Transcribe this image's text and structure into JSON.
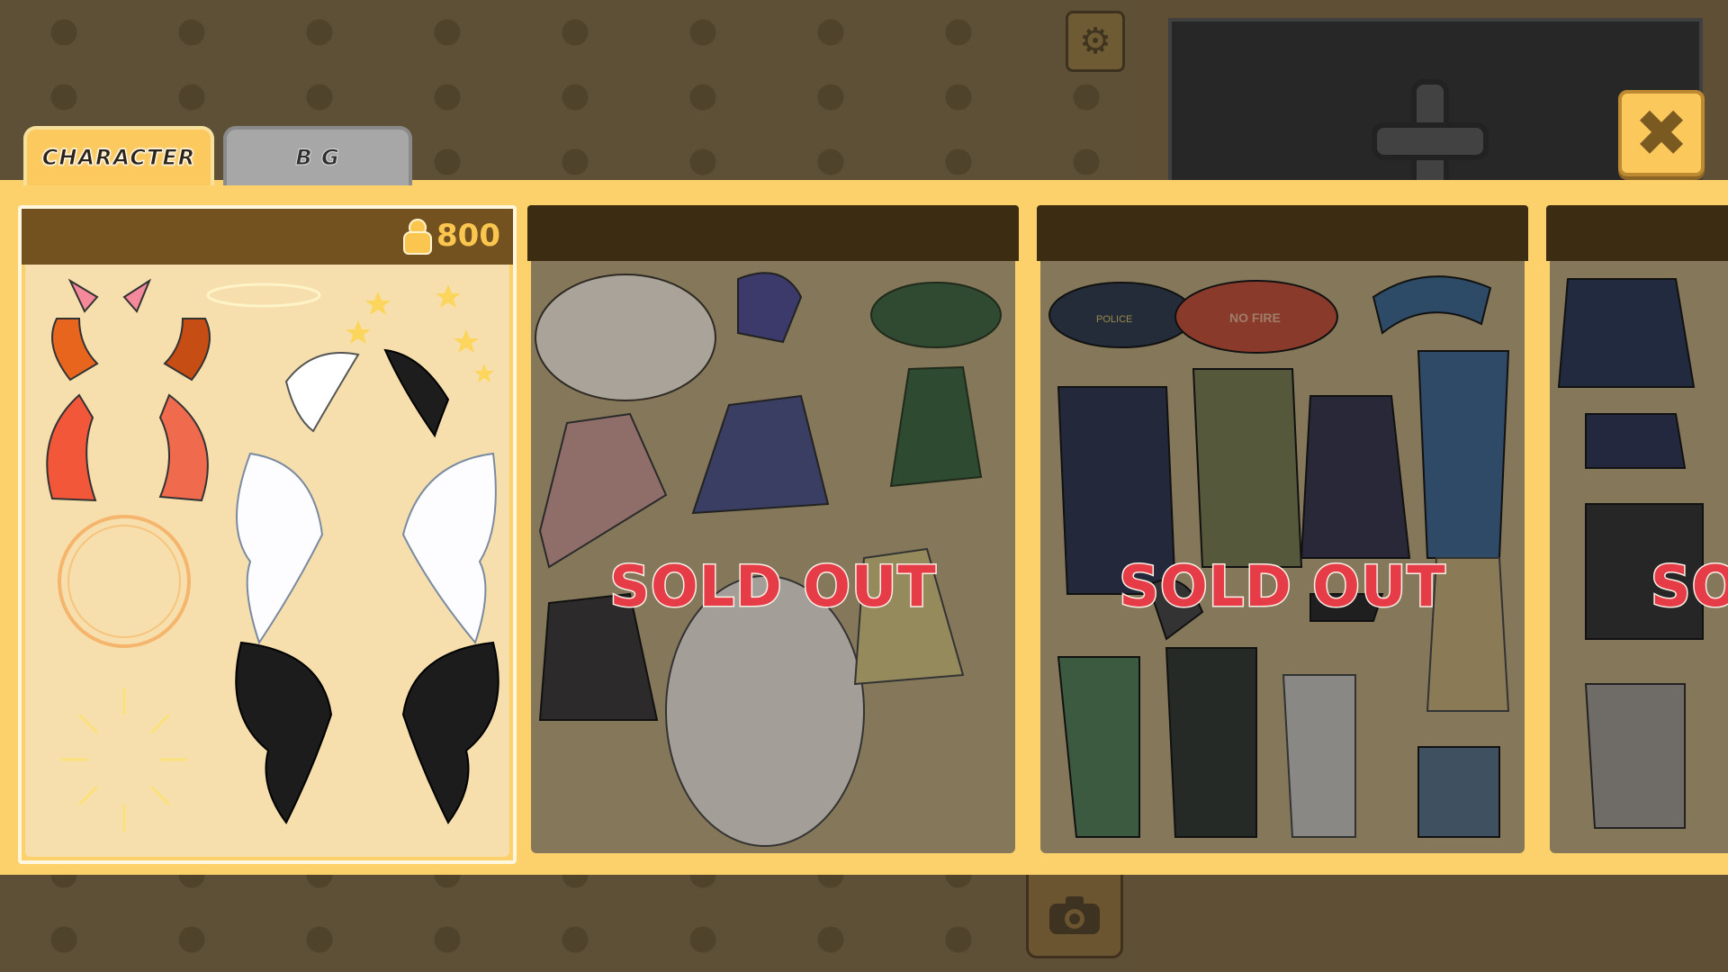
{
  "tabs": [
    {
      "label": "CHARACTER",
      "active": true
    },
    {
      "label": "B G",
      "active": false
    }
  ],
  "cards": [
    {
      "price": "800",
      "sold_out": false
    },
    {
      "sold_out_label": "SOLD OUT"
    },
    {
      "sold_out_label": "SOLD OUT"
    },
    {
      "sold_out_label": "SO"
    }
  ],
  "items": {
    "police_cap_text": "POLICE",
    "fire_helmet_text": "NO FIRE"
  },
  "icons": {
    "settings": "gear-icon",
    "close": "close-icon",
    "camera": "camera-icon",
    "add": "plus-icon",
    "currency": "cookie-icon"
  },
  "colors": {
    "tray": "#fcd16b",
    "header": "#73521f",
    "sold_out_text": "#e63c47",
    "price_text": "#fbc64f"
  }
}
